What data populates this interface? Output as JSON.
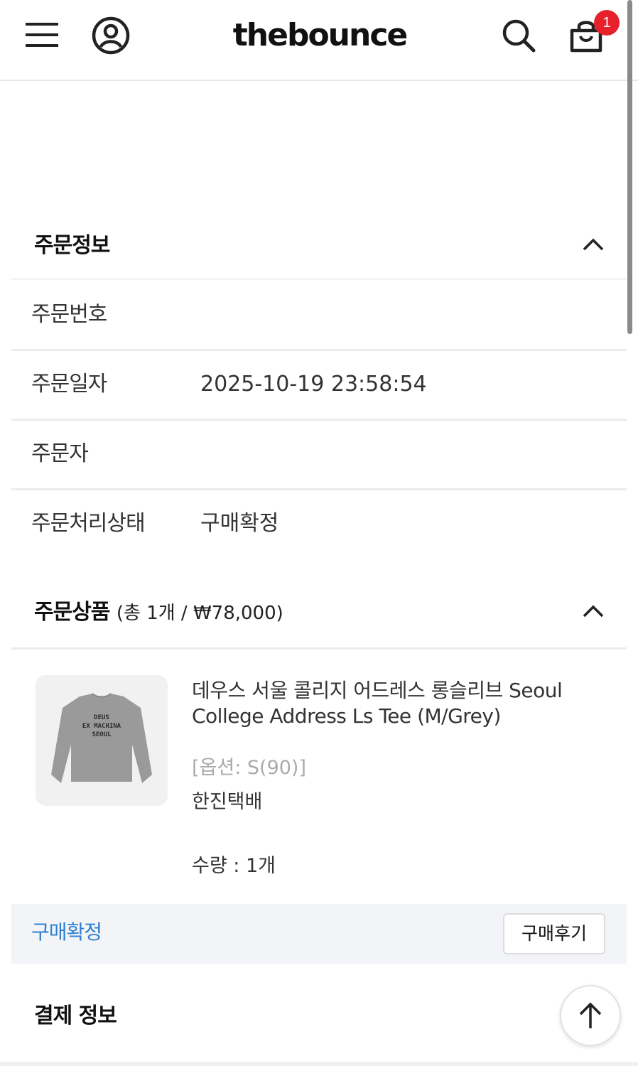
{
  "header": {
    "logo": "thebounce",
    "cart_count": "1",
    "icons": [
      "hamburger-menu-icon",
      "user-profile-icon",
      "search-icon",
      "shopping-bag-icon"
    ]
  },
  "order_info": {
    "title": "주문정보",
    "rows": [
      {
        "label": "주문번호",
        "value": ""
      },
      {
        "label": "주문일자",
        "value": "2025-10-19 23:58:54"
      },
      {
        "label": "주문자",
        "value": ""
      },
      {
        "label": "주문처리상태",
        "value": "구매확정"
      }
    ]
  },
  "order_items": {
    "title": "주문상품",
    "summary": "(총 1개 / ₩78,000)",
    "product": {
      "name": "데우스 서울 콜리지 어드레스 롱슬리브 Seoul College Address Ls Tee (M/Grey)",
      "option": "[옵션: S(90)]",
      "shipping": "한진택배",
      "quantity": "수량 : 1개",
      "print_text": [
        "DEUS",
        "EX MACHINA",
        "SEOUL"
      ]
    },
    "status_link": "구매확정",
    "review_button": "구매후기"
  },
  "payment": {
    "title": "결제 정보"
  },
  "colors": {
    "accent_blue": "#2f7fd0",
    "badge_red": "#e6212b",
    "action_bar_bg": "#f2f4f8"
  }
}
